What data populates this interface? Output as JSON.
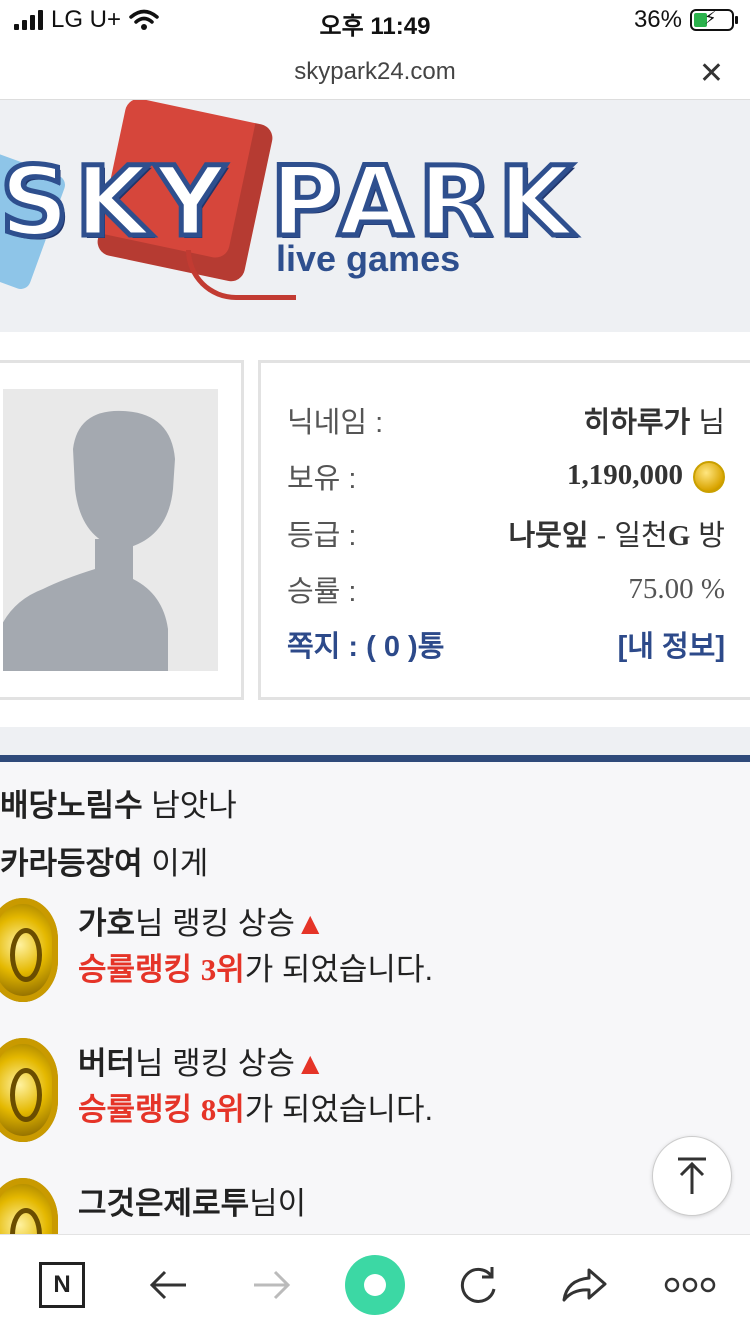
{
  "status_bar": {
    "carrier": "LG U+",
    "time": "오후 11:49",
    "battery": "36%"
  },
  "browser": {
    "url": "skypark24.com"
  },
  "banner": {
    "logo_title": "SKY PARK",
    "logo_sub": "live games"
  },
  "profile": {
    "nickname_label": "닉네임 :",
    "nickname": "히하루가",
    "nickname_suffix": "님",
    "holdings_label": "보유 :",
    "holdings": "1,190,000",
    "grade_label": "등급 :",
    "grade": "나뭇잎",
    "grade_sep": " - ",
    "room_prefix": "일천",
    "room_g": "G",
    "room_suffix": " 방",
    "winrate_label": "승률 :",
    "winrate": "75.00 %",
    "message_text": "쪽지 : ( 0 )통",
    "my_info_link": "[내 정보]"
  },
  "feed": {
    "lines": [
      {
        "user": "배당노림수",
        "text": "남앗나"
      },
      {
        "user": "카라등장여",
        "text": "이게"
      }
    ],
    "rank_items": [
      {
        "user": "가호",
        "suffix": "님 랭킹 상승",
        "arrow": "▲",
        "rank_text": "승률랭킹 ",
        "rank_num": "3위",
        "rest": "가 되었습니다."
      },
      {
        "user": "버터",
        "suffix": "님 랭킹 상승",
        "arrow": "▲",
        "rank_text": "승률랭킹 ",
        "rank_num": "8위",
        "rest": "가 되었습니다."
      },
      {
        "user": "그것은제로투",
        "suffix": "님이"
      }
    ]
  },
  "toolbar": {
    "n_label": "N"
  },
  "colors": {
    "navy": "#2f4a7a",
    "accent_red": "#e53428",
    "brand_green": "#3cd8a4"
  }
}
